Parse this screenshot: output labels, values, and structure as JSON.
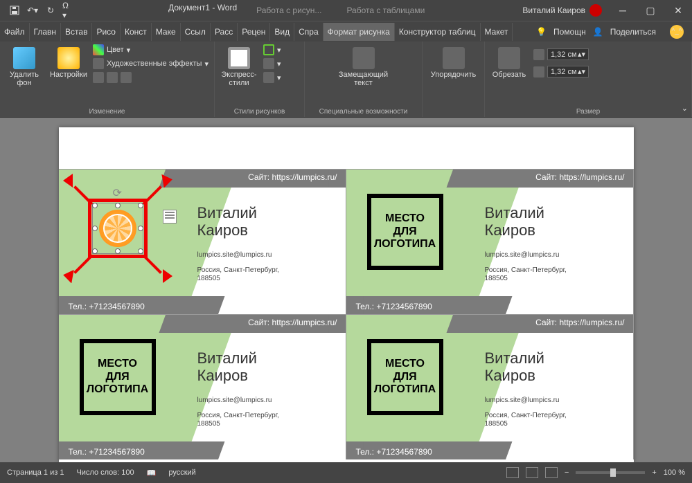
{
  "title": "Документ1 - Word",
  "contextTabs": {
    "pic": "Работа с рисун...",
    "tbl": "Работа с таблицами"
  },
  "user": "Виталий Каиров",
  "menu": [
    "Файл",
    "Главн",
    "Встав",
    "Рисо",
    "Конст",
    "Маке",
    "Ссыл",
    "Расс",
    "Рецен",
    "Вид",
    "Спра",
    "Формат рисунка",
    "Конструктор таблиц",
    "Макет"
  ],
  "menuActive": 11,
  "help": {
    "tell": "Помощн",
    "share": "Поделиться"
  },
  "ribbon": {
    "g1": {
      "btn1": "Удалить\nфон",
      "btn2": "Настройки",
      "r1": "Цвет",
      "r2": "Художественные эффекты",
      "label": "Изменение"
    },
    "g2": {
      "btn": "Экспресс-\nстили",
      "label": "Стили рисунков"
    },
    "g3": {
      "btn": "Замещающий\nтекст",
      "label": "Специальные возможности"
    },
    "g4": {
      "btn": "Упорядочить"
    },
    "g5": {
      "btn": "Обрезать",
      "h": "1,32 см",
      "w": "1,32 см",
      "label": "Размер"
    }
  },
  "card": {
    "site": "Сайт: https://lumpics.ru/",
    "tel": "Тел.: +71234567890",
    "name1": "Виталий",
    "name2": "Каиров",
    "email": "lumpics.site@lumpics.ru",
    "addr1": "Россия, Санкт-Петербург,",
    "addr2": "188505",
    "logo1": "МЕСТО",
    "logo2": "ДЛЯ",
    "logo3": "ЛОГОТИПА"
  },
  "status": {
    "page": "Страница 1 из 1",
    "words": "Число слов: 100",
    "lang": "русский",
    "zoom": "100 %"
  }
}
